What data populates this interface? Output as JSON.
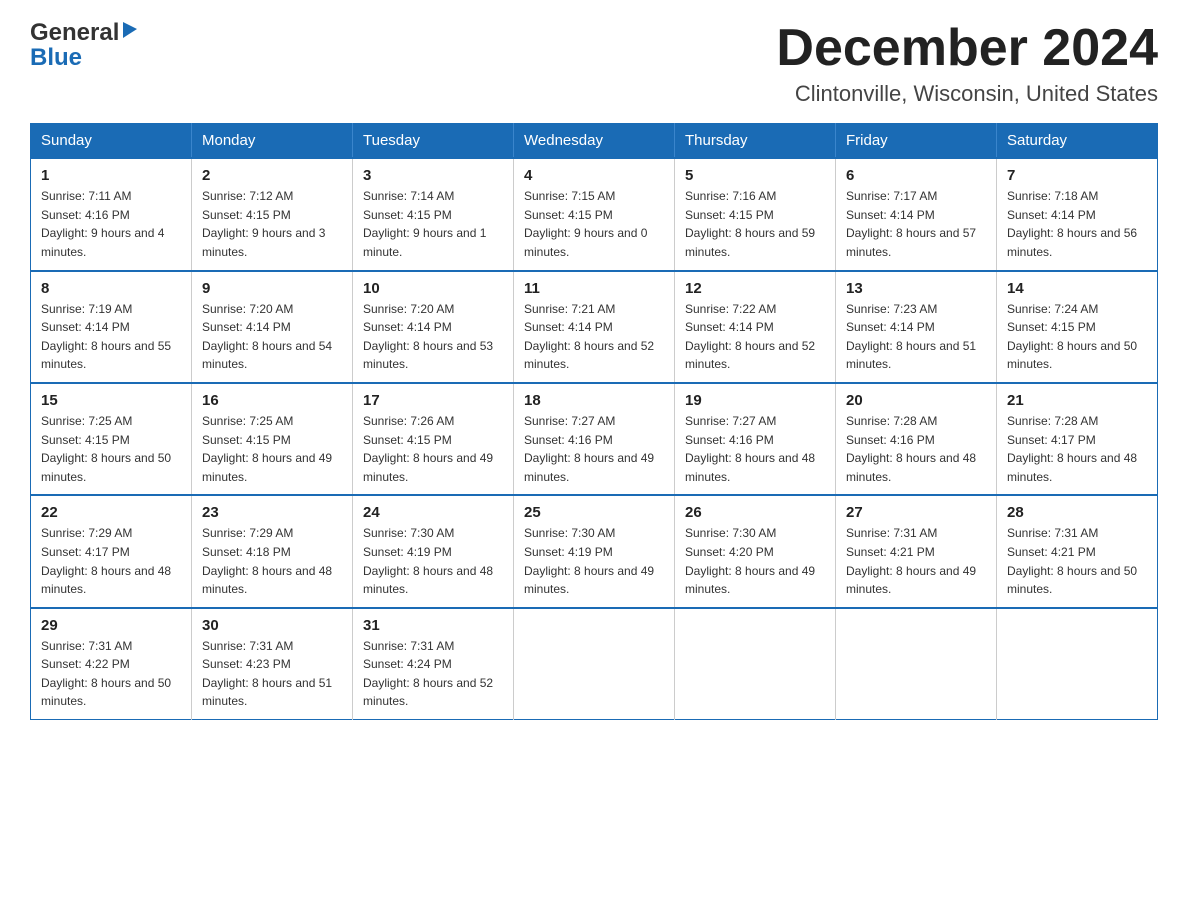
{
  "logo": {
    "line1": "General",
    "triangle": "▶",
    "line2": "Blue"
  },
  "title": "December 2024",
  "location": "Clintonville, Wisconsin, United States",
  "weekdays": [
    "Sunday",
    "Monday",
    "Tuesday",
    "Wednesday",
    "Thursday",
    "Friday",
    "Saturday"
  ],
  "weeks": [
    [
      {
        "day": "1",
        "sunrise": "7:11 AM",
        "sunset": "4:16 PM",
        "daylight": "9 hours and 4 minutes."
      },
      {
        "day": "2",
        "sunrise": "7:12 AM",
        "sunset": "4:15 PM",
        "daylight": "9 hours and 3 minutes."
      },
      {
        "day": "3",
        "sunrise": "7:14 AM",
        "sunset": "4:15 PM",
        "daylight": "9 hours and 1 minute."
      },
      {
        "day": "4",
        "sunrise": "7:15 AM",
        "sunset": "4:15 PM",
        "daylight": "9 hours and 0 minutes."
      },
      {
        "day": "5",
        "sunrise": "7:16 AM",
        "sunset": "4:15 PM",
        "daylight": "8 hours and 59 minutes."
      },
      {
        "day": "6",
        "sunrise": "7:17 AM",
        "sunset": "4:14 PM",
        "daylight": "8 hours and 57 minutes."
      },
      {
        "day": "7",
        "sunrise": "7:18 AM",
        "sunset": "4:14 PM",
        "daylight": "8 hours and 56 minutes."
      }
    ],
    [
      {
        "day": "8",
        "sunrise": "7:19 AM",
        "sunset": "4:14 PM",
        "daylight": "8 hours and 55 minutes."
      },
      {
        "day": "9",
        "sunrise": "7:20 AM",
        "sunset": "4:14 PM",
        "daylight": "8 hours and 54 minutes."
      },
      {
        "day": "10",
        "sunrise": "7:20 AM",
        "sunset": "4:14 PM",
        "daylight": "8 hours and 53 minutes."
      },
      {
        "day": "11",
        "sunrise": "7:21 AM",
        "sunset": "4:14 PM",
        "daylight": "8 hours and 52 minutes."
      },
      {
        "day": "12",
        "sunrise": "7:22 AM",
        "sunset": "4:14 PM",
        "daylight": "8 hours and 52 minutes."
      },
      {
        "day": "13",
        "sunrise": "7:23 AM",
        "sunset": "4:14 PM",
        "daylight": "8 hours and 51 minutes."
      },
      {
        "day": "14",
        "sunrise": "7:24 AM",
        "sunset": "4:15 PM",
        "daylight": "8 hours and 50 minutes."
      }
    ],
    [
      {
        "day": "15",
        "sunrise": "7:25 AM",
        "sunset": "4:15 PM",
        "daylight": "8 hours and 50 minutes."
      },
      {
        "day": "16",
        "sunrise": "7:25 AM",
        "sunset": "4:15 PM",
        "daylight": "8 hours and 49 minutes."
      },
      {
        "day": "17",
        "sunrise": "7:26 AM",
        "sunset": "4:15 PM",
        "daylight": "8 hours and 49 minutes."
      },
      {
        "day": "18",
        "sunrise": "7:27 AM",
        "sunset": "4:16 PM",
        "daylight": "8 hours and 49 minutes."
      },
      {
        "day": "19",
        "sunrise": "7:27 AM",
        "sunset": "4:16 PM",
        "daylight": "8 hours and 48 minutes."
      },
      {
        "day": "20",
        "sunrise": "7:28 AM",
        "sunset": "4:16 PM",
        "daylight": "8 hours and 48 minutes."
      },
      {
        "day": "21",
        "sunrise": "7:28 AM",
        "sunset": "4:17 PM",
        "daylight": "8 hours and 48 minutes."
      }
    ],
    [
      {
        "day": "22",
        "sunrise": "7:29 AM",
        "sunset": "4:17 PM",
        "daylight": "8 hours and 48 minutes."
      },
      {
        "day": "23",
        "sunrise": "7:29 AM",
        "sunset": "4:18 PM",
        "daylight": "8 hours and 48 minutes."
      },
      {
        "day": "24",
        "sunrise": "7:30 AM",
        "sunset": "4:19 PM",
        "daylight": "8 hours and 48 minutes."
      },
      {
        "day": "25",
        "sunrise": "7:30 AM",
        "sunset": "4:19 PM",
        "daylight": "8 hours and 49 minutes."
      },
      {
        "day": "26",
        "sunrise": "7:30 AM",
        "sunset": "4:20 PM",
        "daylight": "8 hours and 49 minutes."
      },
      {
        "day": "27",
        "sunrise": "7:31 AM",
        "sunset": "4:21 PM",
        "daylight": "8 hours and 49 minutes."
      },
      {
        "day": "28",
        "sunrise": "7:31 AM",
        "sunset": "4:21 PM",
        "daylight": "8 hours and 50 minutes."
      }
    ],
    [
      {
        "day": "29",
        "sunrise": "7:31 AM",
        "sunset": "4:22 PM",
        "daylight": "8 hours and 50 minutes."
      },
      {
        "day": "30",
        "sunrise": "7:31 AM",
        "sunset": "4:23 PM",
        "daylight": "8 hours and 51 minutes."
      },
      {
        "day": "31",
        "sunrise": "7:31 AM",
        "sunset": "4:24 PM",
        "daylight": "8 hours and 52 minutes."
      },
      null,
      null,
      null,
      null
    ]
  ],
  "labels": {
    "sunrise_prefix": "Sunrise: ",
    "sunset_prefix": "Sunset: ",
    "daylight_prefix": "Daylight: "
  }
}
